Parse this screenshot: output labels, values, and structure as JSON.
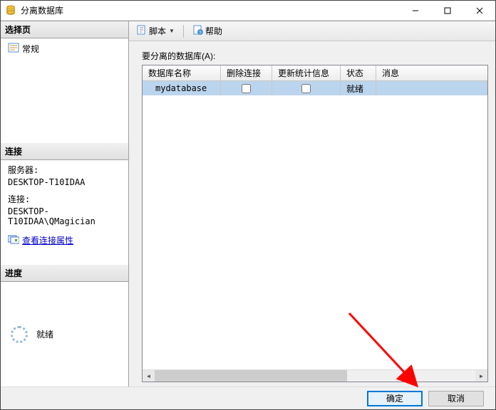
{
  "window": {
    "title": "分离数据库"
  },
  "sidebar": {
    "select_header": "选择页",
    "general": "常规",
    "conn_header": "连接",
    "server_label": "服务器:",
    "server_value": "DESKTOP-T10IDAA",
    "conn_label": "连接:",
    "conn_value": "DESKTOP-T10IDAA\\QMagician",
    "view_conn_props": "查看连接属性",
    "progress_header": "进度",
    "progress_status": "就绪"
  },
  "toolbar": {
    "script": "脚本",
    "help": "帮助"
  },
  "content": {
    "table_label": "要分离的数据库(A):",
    "columns": {
      "name": "数据库名称",
      "drop": "删除连接",
      "update": "更新统计信息",
      "status": "状态",
      "message": "消息"
    },
    "rows": [
      {
        "name": "mydatabase",
        "drop": false,
        "update": false,
        "status": "就绪",
        "message": ""
      }
    ]
  },
  "footer": {
    "ok": "确定",
    "cancel": "取消"
  }
}
